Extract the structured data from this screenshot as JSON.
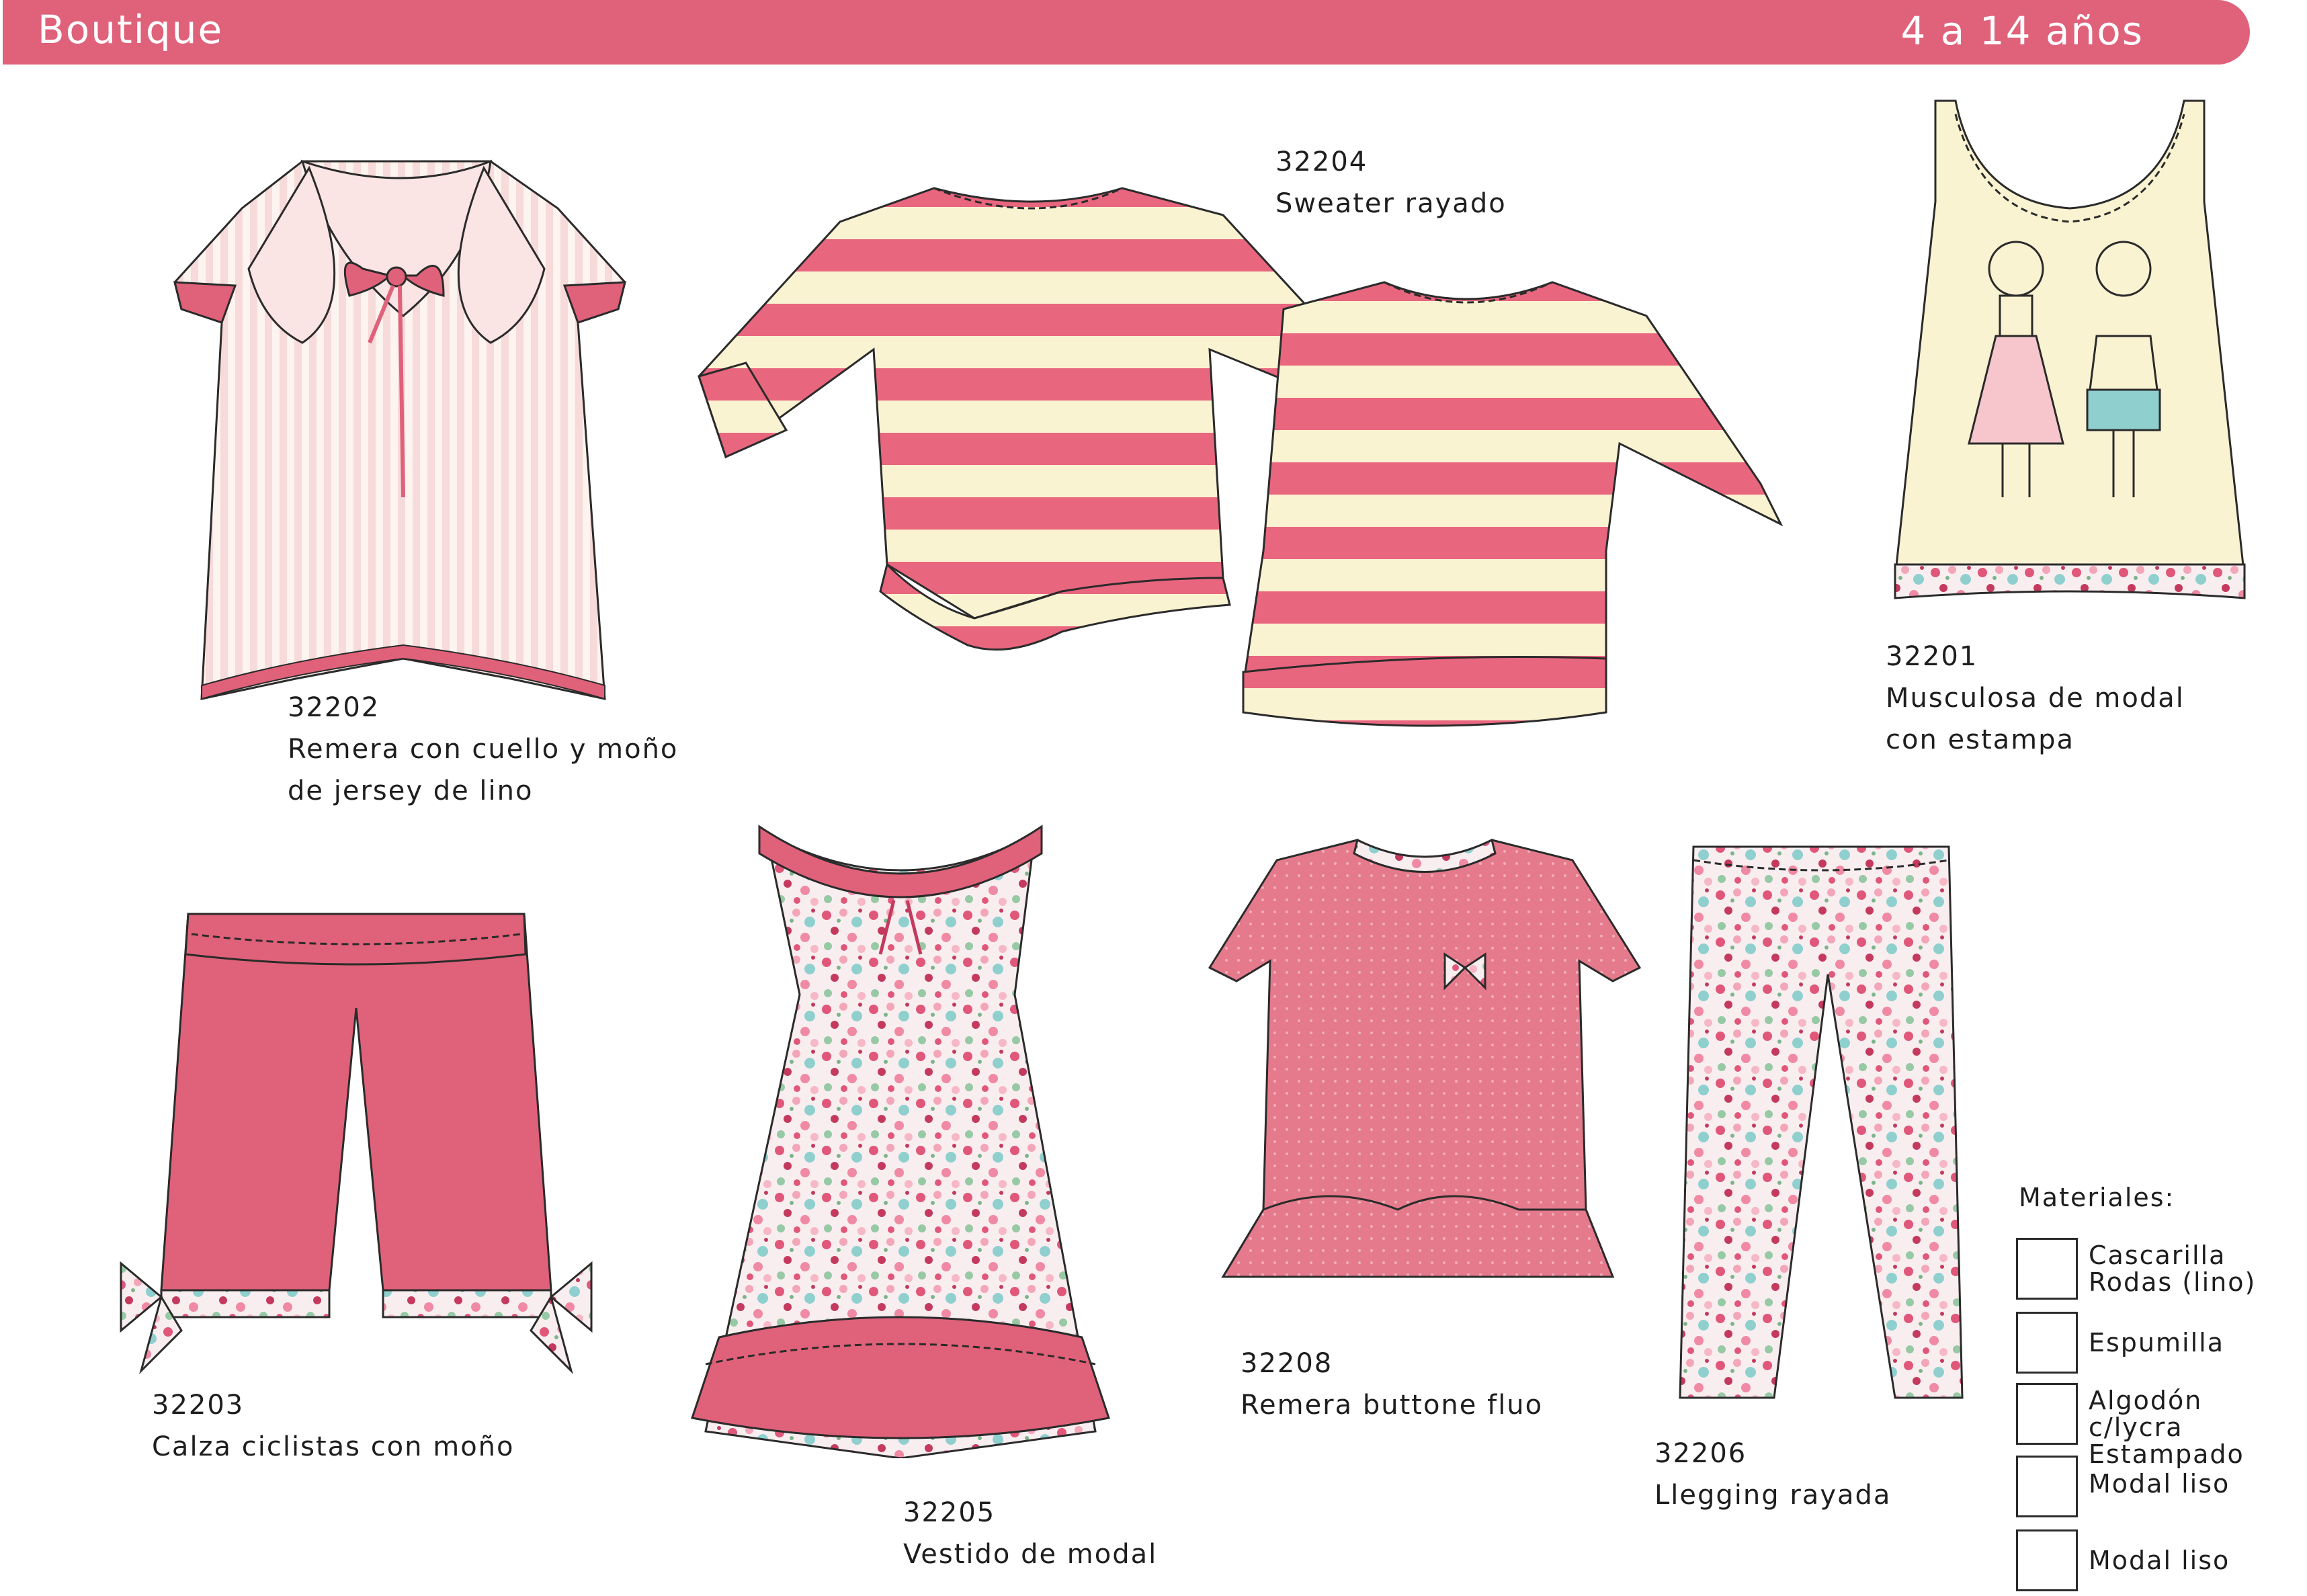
{
  "header": {
    "title": "Boutique",
    "age_range": "4 a 14 años"
  },
  "colors": {
    "brand_pink": "#e0617a",
    "cream": "#faf3d2",
    "stripe_pink": "#e9667f",
    "light_pink": "#f6d6d6"
  },
  "garments": [
    {
      "code": "32202",
      "desc_1": "Remera con cuello y moño",
      "desc_2": "de jersey de lino"
    },
    {
      "code": "32204",
      "desc_1": "Sweater rayado",
      "desc_2": ""
    },
    {
      "code": "32201",
      "desc_1": "Musculosa de modal",
      "desc_2": "con estampa"
    },
    {
      "code": "32203",
      "desc_1": "Calza ciclistas con moño",
      "desc_2": ""
    },
    {
      "code": "32205",
      "desc_1": "Vestido de modal",
      "desc_2": ""
    },
    {
      "code": "32208",
      "desc_1": "Remera buttone fluo",
      "desc_2": ""
    },
    {
      "code": "32206",
      "desc_1": "Llegging rayada",
      "desc_2": ""
    }
  ],
  "materials": {
    "title": "Materiales:",
    "items": [
      {
        "label": "Cascarilla\nRodas (lino)"
      },
      {
        "label": "Espumilla"
      },
      {
        "label": "Algodón c/lycra\nEstampado"
      },
      {
        "label": "Modal liso"
      },
      {
        "label": "Modal liso"
      }
    ]
  }
}
